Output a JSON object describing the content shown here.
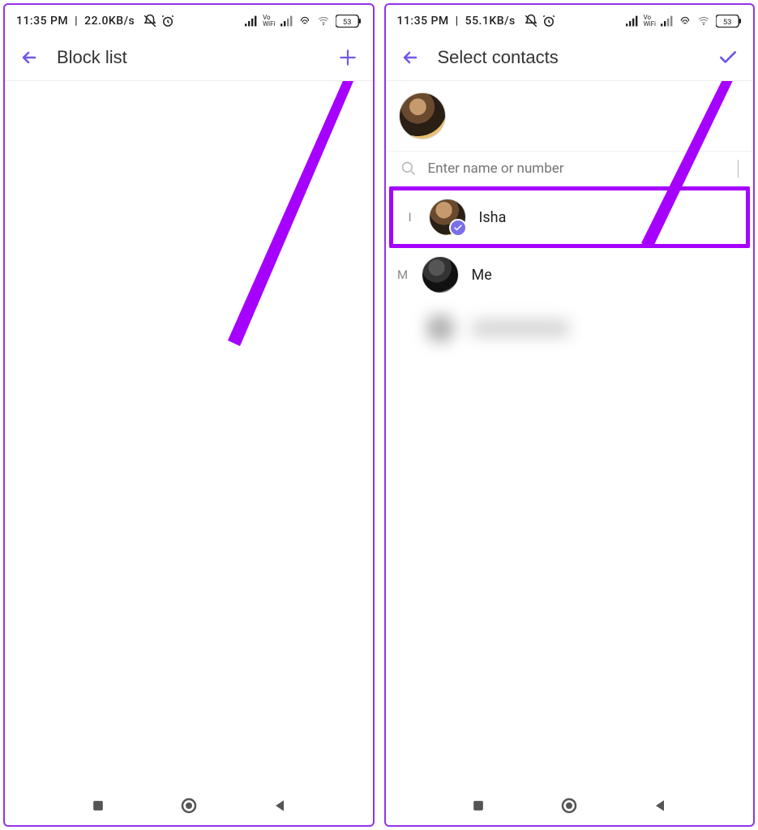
{
  "screen1": {
    "status": {
      "time": "11:35 PM",
      "speed": "22.0KB/s",
      "battery": "53"
    },
    "header": {
      "title": "Block list"
    }
  },
  "screen2": {
    "status": {
      "time": "11:35 PM",
      "speed": "55.1KB/s",
      "battery": "53"
    },
    "header": {
      "title": "Select contacts"
    },
    "search": {
      "placeholder": "Enter name or number"
    },
    "contacts": [
      {
        "letter": "I",
        "name": "Isha",
        "selected": true
      },
      {
        "letter": "M",
        "name": "Me",
        "selected": false
      }
    ]
  }
}
